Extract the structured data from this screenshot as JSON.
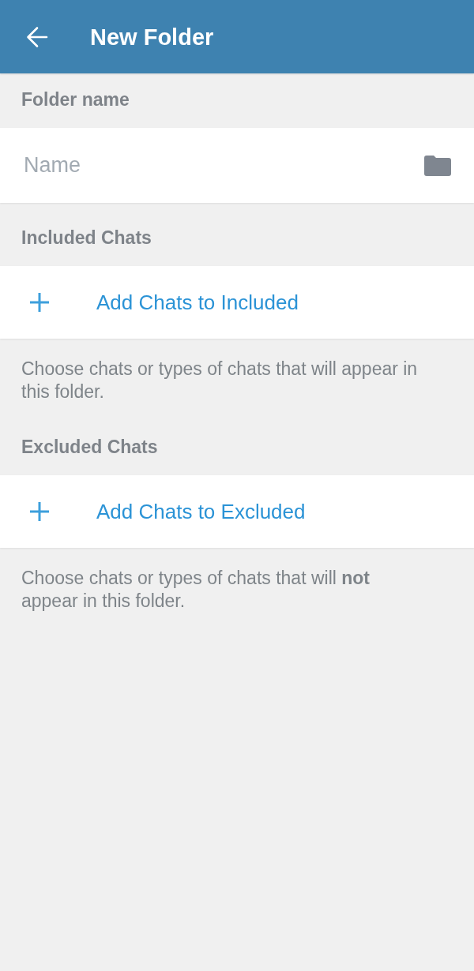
{
  "header": {
    "title": "New Folder"
  },
  "sections": [
    {
      "kind": "name",
      "title": "Folder name",
      "placeholder": "Name"
    },
    {
      "kind": "add",
      "title": "Included Chats",
      "action": "Add Chats to Included",
      "hint": "Choose chats or types of chats that will appear in this folder."
    },
    {
      "kind": "add",
      "title": "Excluded Chats",
      "action": "Add Chats to Excluded",
      "hint": "Choose chats or types of chats that will **not** appear in this folder."
    }
  ]
}
